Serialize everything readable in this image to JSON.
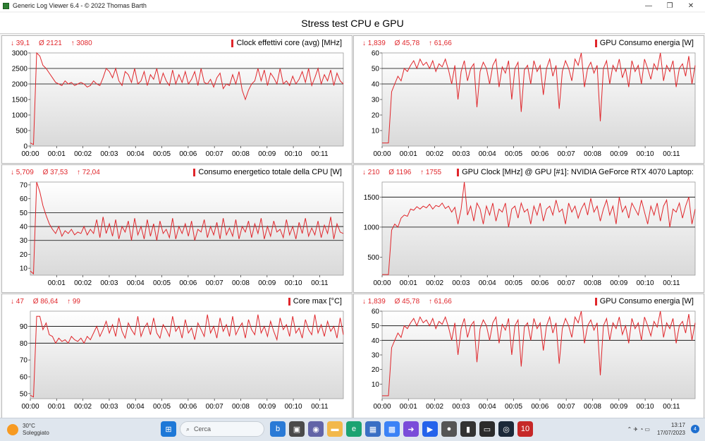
{
  "window": {
    "title": "Generic Log Viewer 6.4 - © 2022 Thomas Barth",
    "controls": [
      "—",
      "❐",
      "✕"
    ]
  },
  "header": {
    "title": "Stress test CPU e GPU"
  },
  "colors": {
    "series": "#e0262b",
    "grid": "#000000",
    "plot_top": "#ffffff",
    "plot_bottom": "#d9d9d9"
  },
  "panels": [
    {
      "title": "Clock effettivi core (avg) [MHz]",
      "min": "↓ 39,1",
      "avg": "Ø 2121",
      "max": "↑ 3080",
      "chart_data": {
        "type": "line",
        "ylim": [
          0,
          3000
        ],
        "yticks": [
          0,
          500,
          1000,
          1500,
          2000,
          2500,
          3000
        ],
        "gridlines": [
          2000,
          2500
        ],
        "xticks": [
          "00:00",
          "00:01",
          "00:02",
          "00:03",
          "00:04",
          "00:05",
          "00:06",
          "00:07",
          "00:08",
          "00:09",
          "00:10",
          "00:11"
        ],
        "x_end_minutes": 11.9,
        "series": [
          {
            "y": [
              100,
              50,
              3050,
              2900,
              2600,
              2500,
              2350,
              2200,
              2050,
              2000,
              1950,
              2100,
              2000,
              2050,
              1950,
              2000,
              2050,
              2000,
              1900,
              1950,
              2100,
              2000,
              1950,
              2200,
              2500,
              2400,
              2200,
              2500,
              2100,
              1950,
              2400,
              2300,
              2050,
              2500,
              2000,
              2100,
              2400,
              1950,
              2300,
              2150,
              2500,
              2000,
              2350,
              2100,
              1950,
              2450,
              2000,
              2300,
              2050,
              2400,
              2000,
              2150,
              2400,
              1950,
              2500,
              2050,
              2000,
              2150,
              1900,
              2200,
              2350,
              1850,
              2000,
              1950,
              2300,
              2000,
              2400,
              1800,
              1500,
              1800,
              2000,
              2100,
              2500,
              2100,
              2450,
              1950,
              2350,
              2200,
              2000,
              2500,
              2000,
              2100,
              1950,
              2250,
              2000,
              2150,
              2400,
              2050,
              2500,
              1950,
              2200,
              2500,
              2000,
              2300,
              2100,
              2450,
              1950,
              2350,
              2100,
              2000
            ]
          }
        ]
      }
    },
    {
      "title": "GPU Consumo energia [W]",
      "min": "↓ 1,839",
      "avg": "Ø 45,78",
      "max": "↑ 61,66",
      "chart_data": {
        "type": "line",
        "ylim": [
          0,
          60
        ],
        "yticks": [
          10,
          20,
          30,
          40,
          50,
          60
        ],
        "gridlines": [
          40,
          50
        ],
        "xticks": [
          "00:00",
          "00:01",
          "00:02",
          "00:03",
          "00:04",
          "00:05",
          "00:06",
          "00:07",
          "00:08",
          "00:09",
          "00:10",
          "00:11"
        ],
        "x_end_minutes": 11.9,
        "series": [
          {
            "y": [
              2,
              2,
              2,
              35,
              40,
              45,
              42,
              50,
              48,
              52,
              55,
              50,
              56,
              52,
              54,
              50,
              55,
              48,
              53,
              51,
              56,
              49,
              40,
              52,
              30,
              48,
              55,
              42,
              50,
              53,
              25,
              48,
              54,
              50,
              40,
              52,
              56,
              38,
              51,
              47,
              55,
              30,
              50,
              54,
              22,
              49,
              52,
              40,
              55,
              48,
              52,
              33,
              50,
              56,
              45,
              52,
              24,
              48,
              55,
              50,
              42,
              56,
              52,
              60,
              38,
              50,
              54,
              47,
              52,
              16,
              50,
              55,
              40,
              52,
              48,
              56,
              44,
              50,
              38,
              55,
              48,
              52,
              40,
              56,
              50,
              43,
              53,
              49,
              60,
              42,
              52,
              48,
              55,
              38,
              50,
              53,
              45,
              58,
              40,
              52
            ]
          }
        ]
      }
    },
    {
      "title": "Consumo energetico totale della CPU [W]",
      "min": "↓ 5,709",
      "avg": "Ø 37,53",
      "max": "↑ 72,04",
      "chart_data": {
        "type": "line",
        "ylim": [
          5,
          72
        ],
        "yticks": [
          10,
          20,
          30,
          40,
          50,
          60,
          70
        ],
        "gridlines": [
          30,
          40,
          50
        ],
        "xticks": [
          "00:01",
          "00:02",
          "00:03",
          "00:04",
          "00:05",
          "00:06",
          "00:07",
          "00:08",
          "00:09",
          "00:10",
          "00:11"
        ],
        "x_end_minutes": 11.9,
        "series": [
          {
            "y": [
              8,
              6,
              72,
              65,
              55,
              48,
              42,
              38,
              35,
              40,
              33,
              37,
              35,
              38,
              34,
              36,
              35,
              40,
              34,
              38,
              35,
              45,
              32,
              47,
              35,
              42,
              33,
              45,
              31,
              40,
              36,
              44,
              30,
              46,
              34,
              40,
              31,
              45,
              33,
              42,
              30,
              44,
              35,
              38,
              32,
              46,
              31,
              40,
              35,
              42,
              33,
              44,
              30,
              38,
              36,
              45,
              32,
              40,
              34,
              43,
              31,
              46,
              34,
              39,
              33,
              45,
              31,
              40,
              36,
              44,
              32,
              42,
              35,
              46,
              31,
              40,
              33,
              44,
              36,
              38,
              32,
              45,
              34,
              40,
              31,
              43,
              35,
              46,
              33,
              39,
              34,
              44,
              32,
              41,
              35,
              47,
              31,
              42,
              36,
              35
            ]
          }
        ]
      }
    },
    {
      "title": "GPU Clock [MHz] @ GPU [#1]: NVIDIA GeForce RTX 4070 Laptop:",
      "min": "↓ 210",
      "avg": "Ø 1196",
      "max": "↑ 1755",
      "chart_data": {
        "type": "line",
        "ylim": [
          200,
          1750
        ],
        "yticks": [
          500,
          1000,
          1500
        ],
        "gridlines": [
          1000,
          1500
        ],
        "xticks": [
          "00:00",
          "00:01",
          "00:02",
          "00:03",
          "00:04",
          "00:05",
          "00:06",
          "00:07",
          "00:08",
          "00:09",
          "00:10",
          "00:11"
        ],
        "x_end_minutes": 11.9,
        "series": [
          {
            "y": [
              210,
              210,
              210,
              950,
              1050,
              1000,
              1150,
              1200,
              1180,
              1300,
              1280,
              1340,
              1300,
              1350,
              1320,
              1380,
              1300,
              1360,
              1340,
              1400,
              1310,
              1350,
              1250,
              1330,
              1050,
              1300,
              1750,
              1200,
              1350,
              1100,
              1400,
              1300,
              1050,
              1350,
              1200,
              1400,
              1100,
              1300,
              1250,
              1400,
              1000,
              1300,
              1350,
              1150,
              1400,
              1250,
              1300,
              1050,
              1350,
              1200,
              1400,
              1100,
              1300,
              1350,
              1200,
              1450,
              1250,
              1300,
              1050,
              1400,
              1250,
              1350,
              1150,
              1300,
              1400,
              1200,
              1480,
              1250,
              1350,
              1100,
              1300,
              1450,
              1200,
              1350,
              1050,
              1500,
              1250,
              1350,
              1150,
              1400,
              1300,
              1200,
              1450,
              1250,
              1050,
              1350,
              1200,
              1400,
              1100,
              1350,
              1450,
              1000,
              1300,
              1250,
              1400,
              1150,
              1350,
              1500,
              1050,
              1300
            ]
          }
        ]
      }
    },
    {
      "title": "Core max [°C]",
      "min": "↓ 47",
      "avg": "Ø 86,64",
      "max": "↑ 99",
      "chart_data": {
        "type": "line",
        "ylim": [
          47,
          99
        ],
        "yticks": [
          50,
          60,
          70,
          80,
          90
        ],
        "gridlines": [
          80,
          90
        ],
        "xticks": [
          "00:00",
          "00:01",
          "00:02",
          "00:03",
          "00:04",
          "00:05",
          "00:06",
          "00:07",
          "00:08",
          "00:09",
          "00:10",
          "00:11"
        ],
        "x_end_minutes": 11.9,
        "series": [
          {
            "y": [
              49,
              48,
              96,
              96,
              88,
              92,
              85,
              84,
              80,
              83,
              81,
              82,
              80,
              84,
              82,
              81,
              83,
              80,
              84,
              82,
              86,
              90,
              84,
              88,
              93,
              86,
              91,
              84,
              95,
              87,
              83,
              92,
              88,
              85,
              96,
              84,
              89,
              92,
              85,
              95,
              86,
              83,
              91,
              88,
              84,
              96,
              87,
              90,
              83,
              94,
              86,
              89,
              82,
              92,
              88,
              84,
              97,
              86,
              90,
              83,
              95,
              87,
              91,
              84,
              96,
              85,
              89,
              92,
              83,
              94,
              88,
              85,
              97,
              86,
              90,
              84,
              93,
              87,
              82,
              95,
              88,
              91,
              84,
              96,
              86,
              89,
              83,
              94,
              88,
              85,
              97,
              86,
              91,
              84,
              93,
              87,
              90,
              83,
              95,
              85
            ]
          }
        ]
      }
    },
    {
      "title": "GPU Consumo energia [W]",
      "min": "↓ 1,839",
      "avg": "Ø 45,78",
      "max": "↑ 61,66",
      "chart_data": {
        "type": "line",
        "ylim": [
          0,
          60
        ],
        "yticks": [
          10,
          20,
          30,
          40,
          50,
          60
        ],
        "gridlines": [
          40,
          50
        ],
        "xticks": [
          "00:00",
          "00:01",
          "00:02",
          "00:03",
          "00:04",
          "00:05",
          "00:06",
          "00:07",
          "00:08",
          "00:09",
          "00:10",
          "00:11"
        ],
        "x_end_minutes": 11.9,
        "series": [
          {
            "y": [
              2,
              2,
              2,
              35,
              40,
              45,
              42,
              50,
              48,
              52,
              55,
              50,
              56,
              52,
              54,
              50,
              55,
              48,
              53,
              51,
              56,
              49,
              40,
              52,
              30,
              48,
              55,
              42,
              50,
              53,
              25,
              48,
              54,
              50,
              40,
              52,
              56,
              38,
              51,
              47,
              55,
              30,
              50,
              54,
              22,
              49,
              52,
              40,
              55,
              48,
              52,
              33,
              50,
              56,
              45,
              52,
              24,
              48,
              55,
              50,
              42,
              56,
              52,
              60,
              38,
              50,
              54,
              47,
              52,
              16,
              50,
              55,
              40,
              52,
              48,
              56,
              44,
              50,
              38,
              55,
              48,
              52,
              40,
              56,
              50,
              43,
              53,
              49,
              60,
              42,
              52,
              48,
              55,
              38,
              50,
              53,
              45,
              58,
              40,
              52
            ]
          }
        ]
      }
    }
  ],
  "taskbar": {
    "weather_temp": "30°C",
    "weather_desc": "Soleggiato",
    "search_placeholder": "Cerca",
    "app_icons": [
      {
        "name": "windows-start",
        "color": "#1e78d7",
        "glyph": "⊞"
      },
      {
        "name": "bing-app",
        "color": "#2a7ad6",
        "glyph": "b"
      },
      {
        "name": "task-view",
        "color": "#4a4a4a",
        "glyph": "▣"
      },
      {
        "name": "teams-chat",
        "color": "#6264a7",
        "glyph": "◉"
      },
      {
        "name": "file-explorer",
        "color": "#f2b84b",
        "glyph": "▬"
      },
      {
        "name": "edge-browser",
        "color": "#1ba371",
        "glyph": "e"
      },
      {
        "name": "store",
        "color": "#3a6fc4",
        "glyph": "▦"
      },
      {
        "name": "widgets-app",
        "color": "#3b82f6",
        "glyph": "▩"
      },
      {
        "name": "media-app",
        "color": "#7a4cd9",
        "glyph": "➜"
      },
      {
        "name": "video-app",
        "color": "#2563eb",
        "glyph": "▶"
      },
      {
        "name": "camera-app",
        "color": "#555555",
        "glyph": "●"
      },
      {
        "name": "sensor-app",
        "color": "#333333",
        "glyph": "▮"
      },
      {
        "name": "terminal-app",
        "color": "#2b2b2b",
        "glyph": "▭"
      },
      {
        "name": "steam-app",
        "color": "#1b2838",
        "glyph": "◎"
      },
      {
        "name": "log-viewer-app",
        "color": "#c62828",
        "glyph": "10"
      }
    ],
    "tray_icons": "⌃ ✈ ◔ ▭",
    "time": "13:17",
    "date": "17/07/2023",
    "notifications": "4"
  }
}
